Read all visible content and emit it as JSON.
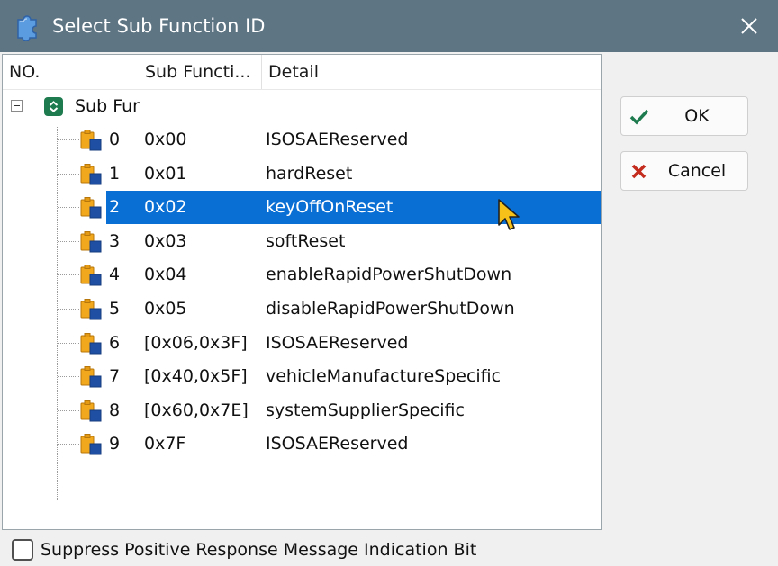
{
  "window": {
    "title": "Select Sub Function ID",
    "app_icon": "puzzle-piece-icon",
    "close_icon": "close-icon"
  },
  "tree": {
    "columns": [
      "NO.",
      "Sub Functi...",
      "Detail"
    ],
    "root": {
      "label": "Sub Function",
      "icon": "collapse-expand-icon",
      "expanded": true
    },
    "node_icon": "folder-document-icon",
    "selected_index": 2,
    "rows": [
      {
        "no": "0",
        "sub_function": "0x00",
        "detail": "ISOSAEReserved"
      },
      {
        "no": "1",
        "sub_function": "0x01",
        "detail": "hardReset"
      },
      {
        "no": "2",
        "sub_function": "0x02",
        "detail": "keyOffOnReset"
      },
      {
        "no": "3",
        "sub_function": "0x03",
        "detail": "softReset"
      },
      {
        "no": "4",
        "sub_function": "0x04",
        "detail": "enableRapidPowerShutDown"
      },
      {
        "no": "5",
        "sub_function": "0x05",
        "detail": "disableRapidPowerShutDown"
      },
      {
        "no": "6",
        "sub_function": "[0x06,0x3F]",
        "detail": "ISOSAEReserved"
      },
      {
        "no": "7",
        "sub_function": "[0x40,0x5F]",
        "detail": "vehicleManufactureSpecific"
      },
      {
        "no": "8",
        "sub_function": "[0x60,0x7E]",
        "detail": "systemSupplierSpecific"
      },
      {
        "no": "9",
        "sub_function": "0x7F",
        "detail": "ISOSAEReserved"
      }
    ]
  },
  "buttons": {
    "ok_label": "OK",
    "ok_icon": "checkmark-icon",
    "cancel_label": "Cancel",
    "cancel_icon": "x-icon"
  },
  "footer": {
    "checkbox_label": "Suppress Positive Response Message Indication Bit",
    "checked": false
  },
  "colors": {
    "titlebar": "#5e7584",
    "selection": "#0a6fd4",
    "ok_check": "#1e7b4f",
    "cancel_x": "#c42b1c"
  }
}
